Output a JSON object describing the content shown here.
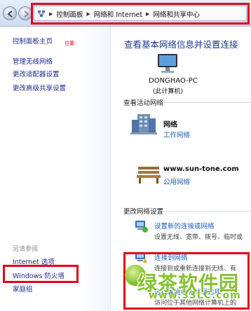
{
  "breadcrumbs": [
    "控制面板",
    "网络和 Internet",
    "网络和共享中心"
  ],
  "sidebar": {
    "home": "控制面板主页",
    "annotation": "位置",
    "items": [
      "管理无线网络",
      "更改适配器设置",
      "更改高级共享设置"
    ],
    "see_also_title": "另请参阅",
    "see_also": [
      "Internet 选项",
      "Windows 防火墙",
      "家庭组"
    ]
  },
  "main": {
    "title": "查看基本网络信息并设置连接",
    "computer": {
      "name": "DONGHAO-PC",
      "sub": "(此计算机)"
    },
    "active_networks_title": "查看活动网络",
    "networks": [
      {
        "name": "网络",
        "type": "工作网络"
      },
      {
        "name": "www.sun-tone.com",
        "type": "公用网络"
      }
    ],
    "change_settings_title": "更改网络设置",
    "actions": [
      {
        "label": "设置新的连接或网络",
        "desc": "设置无线、宽带、拨号、临时或"
      },
      {
        "label": "连接到网络",
        "desc": "连接到或重新连接到无线、有"
      },
      {
        "label": "选择家庭组和共享选项",
        "desc": "访问位于其他网络计算机上的"
      }
    ]
  },
  "watermark": {
    "brand": "绿茶软件园",
    "url": "www.33LC.com"
  },
  "colors": {
    "highlight": "#e2001a",
    "link": "#1b5fb7",
    "watermark": "#86c232"
  }
}
